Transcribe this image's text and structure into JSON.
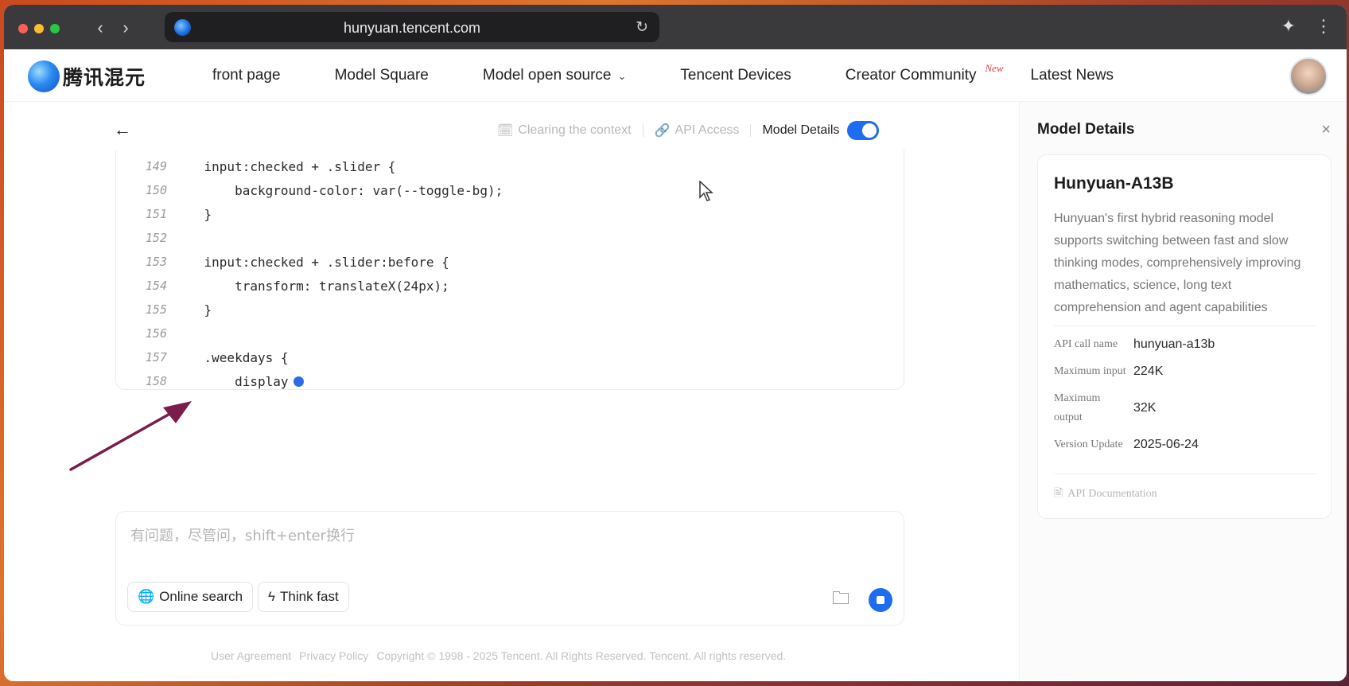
{
  "browser": {
    "url": "hunyuan.tencent.com"
  },
  "header": {
    "logo_text": "腾讯混元",
    "nav": [
      {
        "label": "front page"
      },
      {
        "label": "Model Square"
      },
      {
        "label": "Model open source"
      },
      {
        "label": "Tencent Devices"
      },
      {
        "label": "Creator Community"
      },
      {
        "label": "Latest News"
      }
    ],
    "new_badge": "New"
  },
  "toolbar": {
    "clear_context": "Clearing the context",
    "api_access": "API Access",
    "model_details": "Model Details",
    "model_details_enabled": true
  },
  "code": {
    "lines": [
      {
        "n": "149",
        "text": "    input:checked + .slider {"
      },
      {
        "n": "150",
        "text": "        background-color: var(--toggle-bg);"
      },
      {
        "n": "151",
        "text": "    }"
      },
      {
        "n": "152",
        "text": ""
      },
      {
        "n": "153",
        "text": "    input:checked + .slider:before {"
      },
      {
        "n": "154",
        "text": "        transform: translateX(24px);"
      },
      {
        "n": "155",
        "text": "    }"
      },
      {
        "n": "156",
        "text": ""
      },
      {
        "n": "157",
        "text": "    .weekdays {"
      },
      {
        "n": "158",
        "text": "        display"
      }
    ]
  },
  "input": {
    "placeholder": "有问题，尽管问，shift+enter换行",
    "online_search": "Online search",
    "think_fast": "Think fast"
  },
  "footer": {
    "user_agreement": "User Agreement",
    "privacy_policy": "Privacy Policy",
    "copyright": "Copyright © 1998 - 2025 Tencent. All Rights Reserved. Tencent. All rights reserved."
  },
  "panel": {
    "title": "Model Details",
    "model_name": "Hunyuan-A13B",
    "description": "Hunyuan's first hybrid reasoning model supports switching between fast and slow thinking modes, comprehensively improving mathematics, science, long text comprehension and agent capabilities",
    "specs": [
      {
        "label": "API call name",
        "value": "hunyuan-a13b"
      },
      {
        "label": "Maximum input",
        "value": "224K"
      },
      {
        "label": "Maximum output",
        "value": "32K"
      },
      {
        "label": "Version Update",
        "value": "2025-06-24"
      }
    ],
    "doc_link": "API Documentation"
  },
  "colors": {
    "accent": "#1e6cf0",
    "annotation_arrow": "#7a1d4a",
    "new_badge": "#e23b3b"
  }
}
